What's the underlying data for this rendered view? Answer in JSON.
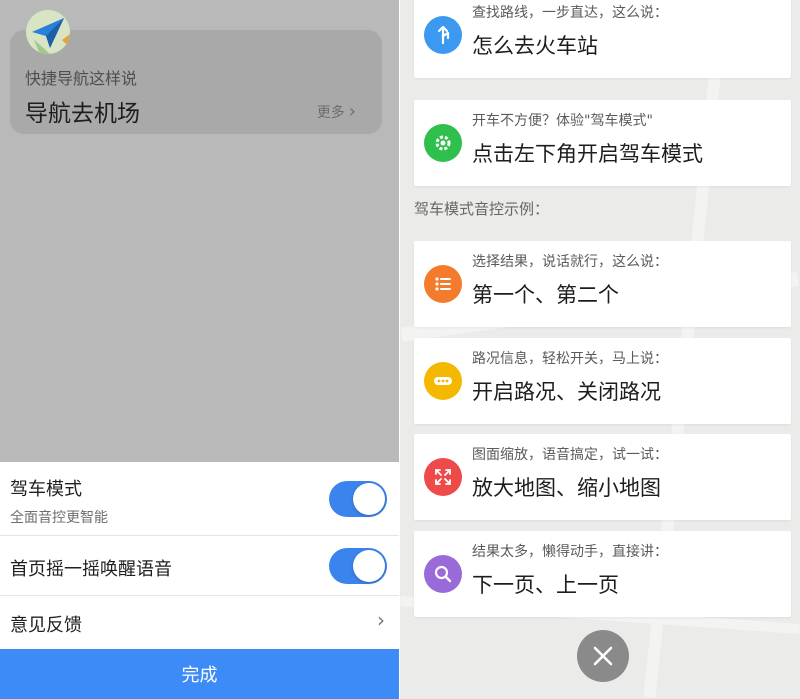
{
  "left": {
    "logo_icon": "paper-plane-icon",
    "tip": {
      "hint": "快捷导航这样说",
      "command": "导航去机场",
      "more": "更多"
    },
    "settings": [
      {
        "title": "驾车模式",
        "subtitle": "全面音控更智能",
        "toggle": true
      },
      {
        "title": "首页摇一摇唤醒语音",
        "toggle": true
      },
      {
        "title": "意见反馈"
      }
    ],
    "done": "完成"
  },
  "right": {
    "cards_top": [
      {
        "icon": "route-icon",
        "color": "#3b9af0",
        "hint": "查找路线，一步直达，这么说：",
        "command": "怎么去火车站"
      },
      {
        "icon": "gear-icon",
        "color": "#2fbf4d",
        "hint": "开车不方便？体验\"驾车模式\"",
        "command": "点击左下角开启驾车模式"
      }
    ],
    "section_label": "驾车模式音控示例：",
    "cards_bottom": [
      {
        "icon": "list-icon",
        "color": "#f47a2c",
        "hint": "选择结果，说话就行，这么说：",
        "command": "第一个、第二个"
      },
      {
        "icon": "traffic-icon",
        "color": "#f5b800",
        "hint": "路况信息，轻松开关，马上说：",
        "command": "开启路况、关闭路况"
      },
      {
        "icon": "zoom-icon",
        "color": "#ef4a4a",
        "hint": "图面缩放，语音搞定，试一试：",
        "command": "放大地图、缩小地图"
      },
      {
        "icon": "search-icon",
        "color": "#9b6ad9",
        "hint": "结果太多，懒得动手，直接讲：",
        "command": "下一页、上一页"
      }
    ],
    "close_icon": "close-icon"
  }
}
